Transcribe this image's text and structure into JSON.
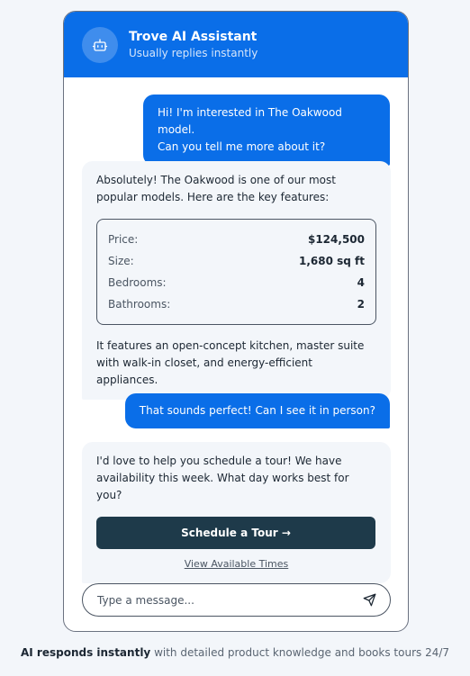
{
  "header": {
    "title": "Trove AI Assistant",
    "subtitle": "Usually replies instantly",
    "avatar_icon": "robot-icon"
  },
  "messages": {
    "user1_line1": "Hi! I'm interested in The Oakwood model.",
    "user1_line2": "Can you tell me more about it?",
    "bot1_intro": "Absolutely! The Oakwood is one of our most popular models. Here are the key features:",
    "specs": [
      {
        "label": "Price:",
        "value": "$124,500"
      },
      {
        "label": "Size:",
        "value": "1,680 sq ft"
      },
      {
        "label": "Bedrooms:",
        "value": "4"
      },
      {
        "label": "Bathrooms:",
        "value": "2"
      }
    ],
    "bot1_outro": "It features an open-concept kitchen, master suite with walk-in closet, and energy-efficient appliances.",
    "user2": "That sounds perfect! Can I see it in person?",
    "bot2_text": "I'd love to help you schedule a tour! We have availability this week. What day works best for you?",
    "bot2_button": "Schedule a Tour →",
    "bot2_link": "View Available Times"
  },
  "composer": {
    "placeholder": "Type a message...",
    "send_icon": "send-icon"
  },
  "footer": {
    "bold": "AI responds instantly",
    "rest": " with detailed product knowledge and books tours 24/7"
  },
  "colors": {
    "brand": "#0a6ee8",
    "dark_button": "#1e3a4a",
    "bubble_bg": "#f3f6fa"
  }
}
